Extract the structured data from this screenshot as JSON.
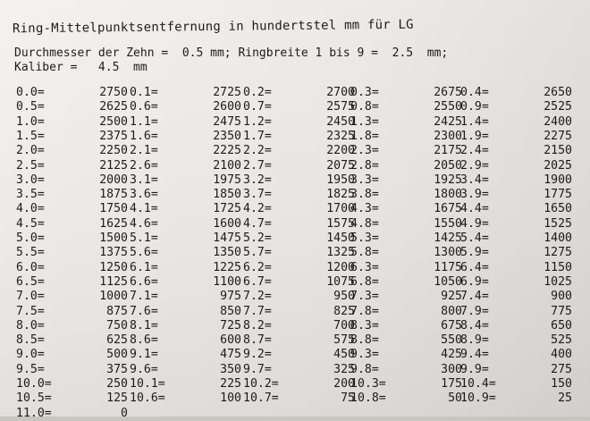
{
  "document": {
    "title": "Ring-Mittelpunktsentfernung in hundertstel mm für LG",
    "header_line_1": "Durchmesser der Zehn =  0.5 mm; Ringbreite 1 bis 9 =  2.5  mm;",
    "header_line_2": "Kaliber =   4.5  mm"
  },
  "table": {
    "columns": [
      {
        "rows": [
          {
            "key": "0.0=",
            "value": "2750"
          },
          {
            "key": "0.5=",
            "value": "2625"
          },
          {
            "key": "1.0=",
            "value": "2500"
          },
          {
            "key": "1.5=",
            "value": "2375"
          },
          {
            "key": "2.0=",
            "value": "2250"
          },
          {
            "key": "2.5=",
            "value": "2125"
          },
          {
            "key": "3.0=",
            "value": "2000"
          },
          {
            "key": "3.5=",
            "value": "1875"
          },
          {
            "key": "4.0=",
            "value": "1750"
          },
          {
            "key": "4.5=",
            "value": "1625"
          },
          {
            "key": "5.0=",
            "value": "1500"
          },
          {
            "key": "5.5=",
            "value": "1375"
          },
          {
            "key": "6.0=",
            "value": "1250"
          },
          {
            "key": "6.5=",
            "value": "1125"
          },
          {
            "key": "7.0=",
            "value": "1000"
          },
          {
            "key": "7.5=",
            "value": "875"
          },
          {
            "key": "8.0=",
            "value": "750"
          },
          {
            "key": "8.5=",
            "value": "625"
          },
          {
            "key": "9.0=",
            "value": "500"
          },
          {
            "key": "9.5=",
            "value": "375"
          },
          {
            "key": "10.0=",
            "value": "250"
          },
          {
            "key": "10.5=",
            "value": "125"
          },
          {
            "key": "11.0=",
            "value": "0"
          }
        ]
      },
      {
        "rows": [
          {
            "key": "0.1=",
            "value": "2725"
          },
          {
            "key": "0.6=",
            "value": "2600"
          },
          {
            "key": "1.1=",
            "value": "2475"
          },
          {
            "key": "1.6=",
            "value": "2350"
          },
          {
            "key": "2.1=",
            "value": "2225"
          },
          {
            "key": "2.6=",
            "value": "2100"
          },
          {
            "key": "3.1=",
            "value": "1975"
          },
          {
            "key": "3.6=",
            "value": "1850"
          },
          {
            "key": "4.1=",
            "value": "1725"
          },
          {
            "key": "4.6=",
            "value": "1600"
          },
          {
            "key": "5.1=",
            "value": "1475"
          },
          {
            "key": "5.6=",
            "value": "1350"
          },
          {
            "key": "6.1=",
            "value": "1225"
          },
          {
            "key": "6.6=",
            "value": "1100"
          },
          {
            "key": "7.1=",
            "value": "975"
          },
          {
            "key": "7.6=",
            "value": "850"
          },
          {
            "key": "8.1=",
            "value": "725"
          },
          {
            "key": "8.6=",
            "value": "600"
          },
          {
            "key": "9.1=",
            "value": "475"
          },
          {
            "key": "9.6=",
            "value": "350"
          },
          {
            "key": "10.1=",
            "value": "225"
          },
          {
            "key": "10.6=",
            "value": "100"
          }
        ]
      },
      {
        "rows": [
          {
            "key": "0.2=",
            "value": "2700"
          },
          {
            "key": "0.7=",
            "value": "2575"
          },
          {
            "key": "1.2=",
            "value": "2450"
          },
          {
            "key": "1.7=",
            "value": "2325"
          },
          {
            "key": "2.2=",
            "value": "2200"
          },
          {
            "key": "2.7=",
            "value": "2075"
          },
          {
            "key": "3.2=",
            "value": "1950"
          },
          {
            "key": "3.7=",
            "value": "1825"
          },
          {
            "key": "4.2=",
            "value": "1700"
          },
          {
            "key": "4.7=",
            "value": "1575"
          },
          {
            "key": "5.2=",
            "value": "1450"
          },
          {
            "key": "5.7=",
            "value": "1325"
          },
          {
            "key": "6.2=",
            "value": "1200"
          },
          {
            "key": "6.7=",
            "value": "1075"
          },
          {
            "key": "7.2=",
            "value": "950"
          },
          {
            "key": "7.7=",
            "value": "825"
          },
          {
            "key": "8.2=",
            "value": "700"
          },
          {
            "key": "8.7=",
            "value": "575"
          },
          {
            "key": "9.2=",
            "value": "450"
          },
          {
            "key": "9.7=",
            "value": "325"
          },
          {
            "key": "10.2=",
            "value": "200"
          },
          {
            "key": "10.7=",
            "value": "75"
          }
        ]
      },
      {
        "rows": [
          {
            "key": "0.3=",
            "value": "2675"
          },
          {
            "key": "0.8=",
            "value": "2550"
          },
          {
            "key": "1.3=",
            "value": "2425"
          },
          {
            "key": "1.8=",
            "value": "2300"
          },
          {
            "key": "2.3=",
            "value": "2175"
          },
          {
            "key": "2.8=",
            "value": "2050"
          },
          {
            "key": "3.3=",
            "value": "1925"
          },
          {
            "key": "3.8=",
            "value": "1800"
          },
          {
            "key": "4.3=",
            "value": "1675"
          },
          {
            "key": "4.8=",
            "value": "1550"
          },
          {
            "key": "5.3=",
            "value": "1425"
          },
          {
            "key": "5.8=",
            "value": "1300"
          },
          {
            "key": "6.3=",
            "value": "1175"
          },
          {
            "key": "6.8=",
            "value": "1050"
          },
          {
            "key": "7.3=",
            "value": "925"
          },
          {
            "key": "7.8=",
            "value": "800"
          },
          {
            "key": "8.3=",
            "value": "675"
          },
          {
            "key": "8.8=",
            "value": "550"
          },
          {
            "key": "9.3=",
            "value": "425"
          },
          {
            "key": "9.8=",
            "value": "300"
          },
          {
            "key": "10.3=",
            "value": "175"
          },
          {
            "key": "10.8=",
            "value": "50"
          }
        ]
      },
      {
        "rows": [
          {
            "key": "0.4=",
            "value": "2650"
          },
          {
            "key": "0.9=",
            "value": "2525"
          },
          {
            "key": "1.4=",
            "value": "2400"
          },
          {
            "key": "1.9=",
            "value": "2275"
          },
          {
            "key": "2.4=",
            "value": "2150"
          },
          {
            "key": "2.9=",
            "value": "2025"
          },
          {
            "key": "3.4=",
            "value": "1900"
          },
          {
            "key": "3.9=",
            "value": "1775"
          },
          {
            "key": "4.4=",
            "value": "1650"
          },
          {
            "key": "4.9=",
            "value": "1525"
          },
          {
            "key": "5.4=",
            "value": "1400"
          },
          {
            "key": "5.9=",
            "value": "1275"
          },
          {
            "key": "6.4=",
            "value": "1150"
          },
          {
            "key": "6.9=",
            "value": "1025"
          },
          {
            "key": "7.4=",
            "value": "900"
          },
          {
            "key": "7.9=",
            "value": "775"
          },
          {
            "key": "8.4=",
            "value": "650"
          },
          {
            "key": "8.9=",
            "value": "525"
          },
          {
            "key": "9.4=",
            "value": "400"
          },
          {
            "key": "9.9=",
            "value": "275"
          },
          {
            "key": "10.4=",
            "value": "150"
          },
          {
            "key": "10.9=",
            "value": "25"
          }
        ]
      }
    ]
  }
}
